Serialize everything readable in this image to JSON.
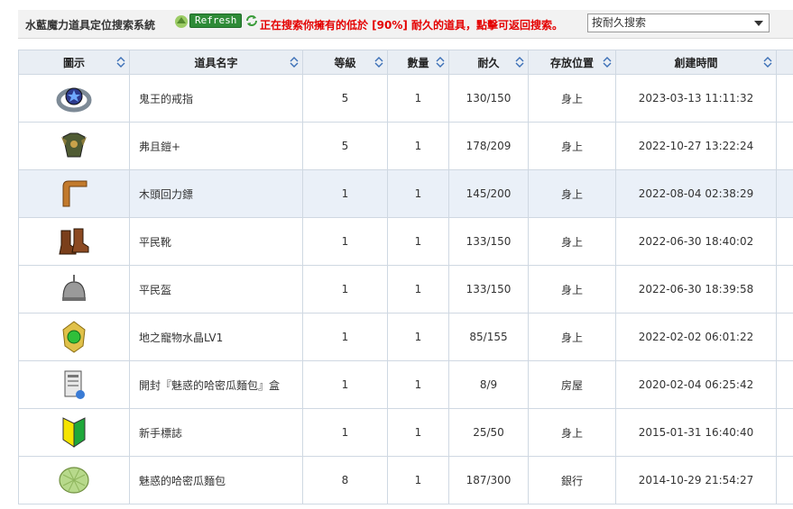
{
  "header": {
    "title": "水藍魔力道具定位搜索系統",
    "refresh_label": "Refresh",
    "notice": "正在搜索你擁有的低於 [90%] 耐久的道具，點擊可返回搜索。",
    "search_mode": "按耐久搜索"
  },
  "table": {
    "columns": [
      "圖示",
      "道具名字",
      "等級",
      "數量",
      "耐久",
      "存放位置",
      "創建時間"
    ],
    "rows": [
      {
        "icon": "ring-icon",
        "name": "鬼王的戒指",
        "level": "5",
        "qty": "1",
        "durability": "130/150",
        "location": "身上",
        "created": "2023-03-13 11:11:32"
      },
      {
        "icon": "armor-icon",
        "name": "弗且鎧+",
        "level": "5",
        "qty": "1",
        "durability": "178/209",
        "location": "身上",
        "created": "2022-10-27 13:22:24"
      },
      {
        "icon": "boomerang-icon",
        "name": "木頭回力鏢",
        "level": "1",
        "qty": "1",
        "durability": "145/200",
        "location": "身上",
        "created": "2022-08-04 02:38:29"
      },
      {
        "icon": "boots-icon",
        "name": "平民靴",
        "level": "1",
        "qty": "1",
        "durability": "133/150",
        "location": "身上",
        "created": "2022-06-30 18:40:02"
      },
      {
        "icon": "helmet-icon",
        "name": "平民盔",
        "level": "1",
        "qty": "1",
        "durability": "133/150",
        "location": "身上",
        "created": "2022-06-30 18:39:58"
      },
      {
        "icon": "crystal-icon",
        "name": "地之寵物水晶LV1",
        "level": "1",
        "qty": "1",
        "durability": "85/155",
        "location": "身上",
        "created": "2022-02-02 06:01:22"
      },
      {
        "icon": "box-icon",
        "name": "開封『魅惑的哈密瓜麵包』盒",
        "level": "1",
        "qty": "1",
        "durability": "8/9",
        "location": "房屋",
        "created": "2020-02-04 06:25:42"
      },
      {
        "icon": "beginner-mark-icon",
        "name": "新手標誌",
        "level": "1",
        "qty": "1",
        "durability": "25/50",
        "location": "身上",
        "created": "2015-01-31 16:40:40"
      },
      {
        "icon": "melon-bread-icon",
        "name": "魅惑的哈密瓜麵包",
        "level": "8",
        "qty": "1",
        "durability": "187/300",
        "location": "銀行",
        "created": "2014-10-29 21:54:27"
      }
    ]
  },
  "colors": {
    "durability": "#e8862a",
    "notice": "#e40000",
    "refresh": "#2e8b37",
    "header_bg": "#e9eef4"
  }
}
